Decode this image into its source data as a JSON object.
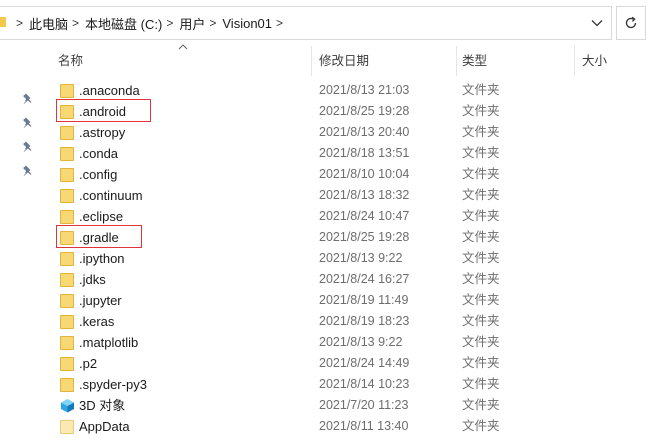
{
  "breadcrumb": {
    "items": [
      "此电脑",
      "本地磁盘 (C:)",
      "用户",
      "Vision01"
    ],
    "separator": ">"
  },
  "columns": {
    "name": "名称",
    "date": "修改日期",
    "type": "类型",
    "size": "大小"
  },
  "files": [
    {
      "name": ".anaconda",
      "date": "2021/8/13 21:03",
      "type": "文件夹",
      "icon": "folder-icon",
      "highlighted": false
    },
    {
      "name": ".android",
      "date": "2021/8/25 19:28",
      "type": "文件夹",
      "icon": "folder-icon",
      "highlighted": true
    },
    {
      "name": ".astropy",
      "date": "2021/8/13 20:40",
      "type": "文件夹",
      "icon": "folder-icon",
      "highlighted": false
    },
    {
      "name": ".conda",
      "date": "2021/8/18 13:51",
      "type": "文件夹",
      "icon": "folder-icon",
      "highlighted": false
    },
    {
      "name": ".config",
      "date": "2021/8/10 10:04",
      "type": "文件夹",
      "icon": "folder-icon",
      "highlighted": false
    },
    {
      "name": ".continuum",
      "date": "2021/8/13 18:32",
      "type": "文件夹",
      "icon": "folder-icon",
      "highlighted": false
    },
    {
      "name": ".eclipse",
      "date": "2021/8/24 10:47",
      "type": "文件夹",
      "icon": "folder-icon",
      "highlighted": false
    },
    {
      "name": ".gradle",
      "date": "2021/8/25 19:28",
      "type": "文件夹",
      "icon": "folder-icon",
      "highlighted": true
    },
    {
      "name": ".ipython",
      "date": "2021/8/13 9:22",
      "type": "文件夹",
      "icon": "folder-icon",
      "highlighted": false
    },
    {
      "name": ".jdks",
      "date": "2021/8/24 16:27",
      "type": "文件夹",
      "icon": "folder-icon",
      "highlighted": false
    },
    {
      "name": ".jupyter",
      "date": "2021/8/19 11:49",
      "type": "文件夹",
      "icon": "folder-icon",
      "highlighted": false
    },
    {
      "name": ".keras",
      "date": "2021/8/19 18:23",
      "type": "文件夹",
      "icon": "folder-icon",
      "highlighted": false
    },
    {
      "name": ".matplotlib",
      "date": "2021/8/13 9:22",
      "type": "文件夹",
      "icon": "folder-icon",
      "highlighted": false
    },
    {
      "name": ".p2",
      "date": "2021/8/24 14:49",
      "type": "文件夹",
      "icon": "folder-icon",
      "highlighted": false
    },
    {
      "name": ".spyder-py3",
      "date": "2021/8/14 10:23",
      "type": "文件夹",
      "icon": "folder-icon",
      "highlighted": false
    },
    {
      "name": "3D 对象",
      "date": "2021/7/20 11:23",
      "type": "文件夹",
      "icon": "3d-objects-icon",
      "highlighted": false
    },
    {
      "name": "AppData",
      "date": "2021/8/11 13:40",
      "type": "文件夹",
      "icon": "appdata-folder-icon",
      "highlighted": false
    }
  ],
  "colors": {
    "folder": "#f8d775",
    "highlight_border": "#e0343a",
    "cube": "#2aa7e0"
  }
}
